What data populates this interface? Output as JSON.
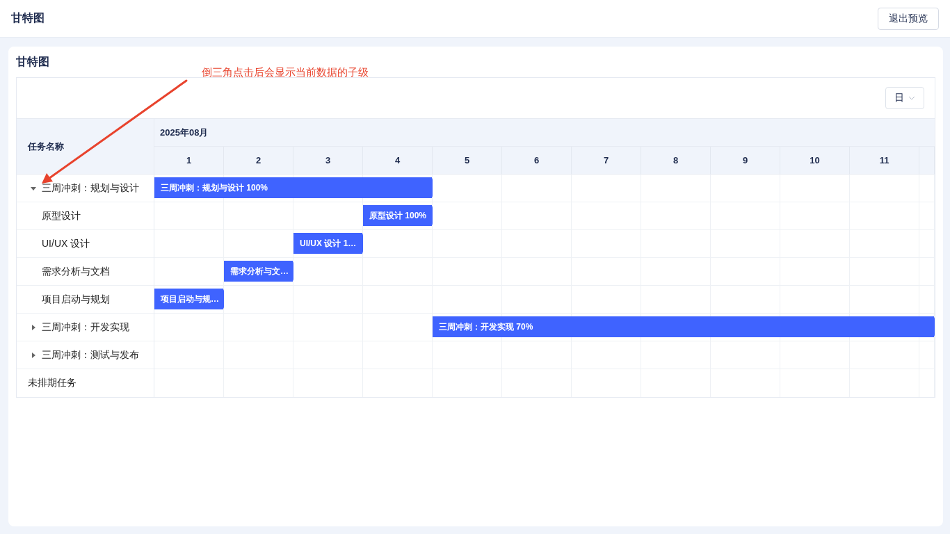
{
  "header": {
    "title": "甘特图",
    "exit_button": "退出预览"
  },
  "card": {
    "title": "甘特图",
    "annotation": "倒三角点击后会显示当前数据的子级"
  },
  "toolbar": {
    "scale_select": "日"
  },
  "gantt": {
    "name_column": "任务名称",
    "month": "2025年08月",
    "days": [
      "1",
      "2",
      "3",
      "4",
      "5",
      "6",
      "7",
      "8",
      "9",
      "10",
      "11"
    ],
    "tasks": [
      {
        "kind": "group",
        "name": "三周冲刺：规划与设计",
        "expanded": true,
        "bar": {
          "label": "三周冲刺：规划与设计 100%",
          "covers": [
            true,
            true,
            true,
            true,
            false,
            false,
            false,
            false,
            false,
            false,
            false,
            false
          ]
        },
        "children": [
          {
            "name": "原型设计",
            "bar": {
              "label": "原型设计 100%",
              "covers": [
                false,
                false,
                false,
                true,
                false,
                false,
                false,
                false,
                false,
                false,
                false,
                false
              ]
            }
          },
          {
            "name": "UI/UX 设计",
            "bar": {
              "label": "UI/UX 设计 1…",
              "covers": [
                false,
                false,
                true,
                false,
                false,
                false,
                false,
                false,
                false,
                false,
                false,
                false
              ]
            }
          },
          {
            "name": "需求分析与文档",
            "bar": {
              "label": "需求分析与文…",
              "covers": [
                false,
                true,
                false,
                false,
                false,
                false,
                false,
                false,
                false,
                false,
                false,
                false
              ]
            }
          },
          {
            "name": "项目启动与规划",
            "bar": {
              "label": "项目启动与规…",
              "covers": [
                true,
                false,
                false,
                false,
                false,
                false,
                false,
                false,
                false,
                false,
                false,
                false
              ]
            }
          }
        ]
      },
      {
        "kind": "group",
        "name": "三周冲刺：开发实现",
        "expanded": false,
        "bar": {
          "label": "三周冲刺：开发实现 70%",
          "covers": [
            false,
            false,
            false,
            false,
            true,
            true,
            true,
            true,
            true,
            true,
            true,
            true
          ]
        }
      },
      {
        "kind": "group",
        "name": "三周冲刺：测试与发布",
        "expanded": false
      },
      {
        "kind": "plain",
        "name": "未排期任务"
      }
    ]
  }
}
